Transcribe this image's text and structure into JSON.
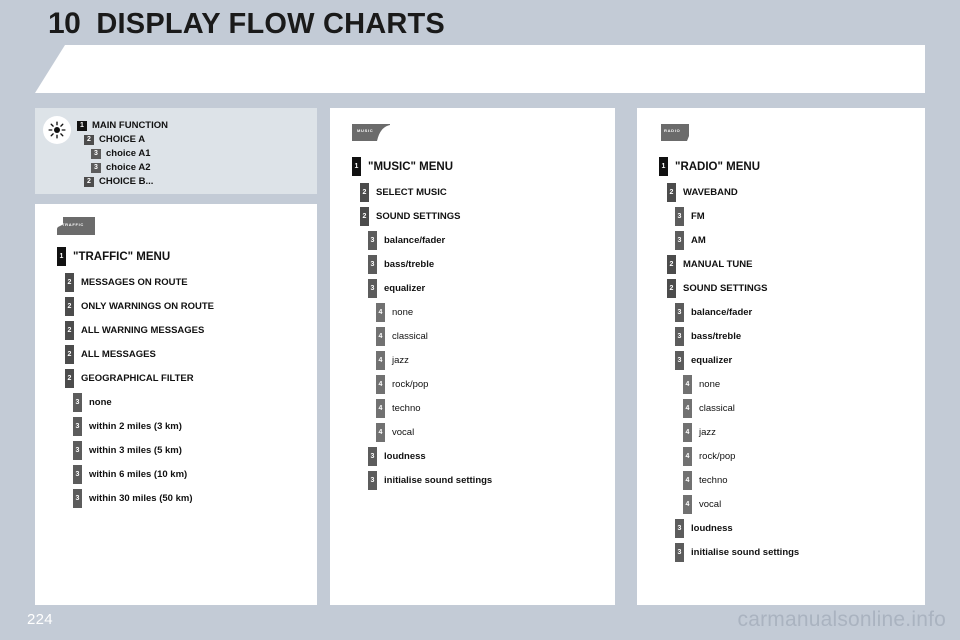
{
  "header": {
    "chapter_number": "10",
    "title": "DISPLAY FLOW CHARTS"
  },
  "legend": {
    "icon": "sun-brightness-icon",
    "rows": [
      {
        "level": 1,
        "badge": "1",
        "label": "MAIN FUNCTION",
        "indent": 0
      },
      {
        "level": 2,
        "badge": "2",
        "label": "CHOICE A",
        "indent": 1
      },
      {
        "level": 3,
        "badge": "3",
        "label": "choice A1",
        "indent": 2
      },
      {
        "level": 3,
        "badge": "3",
        "label": "choice A2",
        "indent": 2
      },
      {
        "level": 2,
        "badge": "2",
        "label": "CHOICE B...",
        "indent": 1
      }
    ]
  },
  "columns": [
    {
      "id": "traffic",
      "tab_icon_label": "TRAFFIC",
      "tab_icon_name": "traffic-tab-icon",
      "nodes": [
        {
          "level": 1,
          "badge": "1",
          "label": "\"TRAFFIC\" MENU"
        },
        {
          "level": 2,
          "badge": "2",
          "label": "MESSAGES ON ROUTE"
        },
        {
          "level": 2,
          "badge": "2",
          "label": "ONLY WARNINGS ON ROUTE"
        },
        {
          "level": 2,
          "badge": "2",
          "label": "ALL WARNING MESSAGES"
        },
        {
          "level": 2,
          "badge": "2",
          "label": "ALL MESSAGES"
        },
        {
          "level": 2,
          "badge": "2",
          "label": "GEOGRAPHICAL FILTER"
        },
        {
          "level": 3,
          "badge": "3",
          "label": "none"
        },
        {
          "level": 3,
          "badge": "3",
          "label": "within 2 miles (3 km)"
        },
        {
          "level": 3,
          "badge": "3",
          "label": "within 3 miles (5 km)"
        },
        {
          "level": 3,
          "badge": "3",
          "label": "within 6 miles (10 km)"
        },
        {
          "level": 3,
          "badge": "3",
          "label": "within 30 miles (50 km)"
        }
      ]
    },
    {
      "id": "music",
      "tab_icon_label": "MUSIC",
      "tab_icon_name": "music-tab-icon",
      "nodes": [
        {
          "level": 1,
          "badge": "1",
          "label": "\"MUSIC\" MENU"
        },
        {
          "level": 2,
          "badge": "2",
          "label": "SELECT MUSIC"
        },
        {
          "level": 2,
          "badge": "2",
          "label": "SOUND SETTINGS"
        },
        {
          "level": 3,
          "badge": "3",
          "label": "balance/fader"
        },
        {
          "level": 3,
          "badge": "3",
          "label": "bass/treble"
        },
        {
          "level": 3,
          "badge": "3",
          "label": "equalizer"
        },
        {
          "level": 4,
          "badge": "4",
          "label": "none"
        },
        {
          "level": 4,
          "badge": "4",
          "label": "classical"
        },
        {
          "level": 4,
          "badge": "4",
          "label": "jazz"
        },
        {
          "level": 4,
          "badge": "4",
          "label": "rock/pop"
        },
        {
          "level": 4,
          "badge": "4",
          "label": "techno"
        },
        {
          "level": 4,
          "badge": "4",
          "label": "vocal"
        },
        {
          "level": 3,
          "badge": "3",
          "label": "loudness"
        },
        {
          "level": 3,
          "badge": "3",
          "label": "initialise sound settings"
        }
      ]
    },
    {
      "id": "radio",
      "tab_icon_label": "RADIO",
      "tab_icon_name": "radio-tab-icon",
      "nodes": [
        {
          "level": 1,
          "badge": "1",
          "label": "\"RADIO\" MENU"
        },
        {
          "level": 2,
          "badge": "2",
          "label": "WAVEBAND"
        },
        {
          "level": 3,
          "badge": "3",
          "label": "FM"
        },
        {
          "level": 3,
          "badge": "3",
          "label": "AM"
        },
        {
          "level": 2,
          "badge": "2",
          "label": "MANUAL TUNE"
        },
        {
          "level": 2,
          "badge": "2",
          "label": "SOUND SETTINGS"
        },
        {
          "level": 3,
          "badge": "3",
          "label": "balance/fader"
        },
        {
          "level": 3,
          "badge": "3",
          "label": "bass/treble"
        },
        {
          "level": 3,
          "badge": "3",
          "label": "equalizer"
        },
        {
          "level": 4,
          "badge": "4",
          "label": "none"
        },
        {
          "level": 4,
          "badge": "4",
          "label": "classical"
        },
        {
          "level": 4,
          "badge": "4",
          "label": "jazz"
        },
        {
          "level": 4,
          "badge": "4",
          "label": "rock/pop"
        },
        {
          "level": 4,
          "badge": "4",
          "label": "techno"
        },
        {
          "level": 4,
          "badge": "4",
          "label": "vocal"
        },
        {
          "level": 3,
          "badge": "3",
          "label": "loudness"
        },
        {
          "level": 3,
          "badge": "3",
          "label": "initialise sound settings"
        }
      ]
    }
  ],
  "footer": {
    "page_number": "224",
    "watermark": "carmanualsonline.info"
  },
  "colors": {
    "background": "#c3cbd6",
    "panel": "#ffffff",
    "legend_panel": "#dde3e8",
    "level1_badge": "#111111",
    "level2_badge": "#4c4c4c",
    "level3_badge": "#5c5c5c",
    "level4_badge": "#717171",
    "tab_icon": "#6b6b6b",
    "page_number": "#ffffff",
    "watermark": "#aab3c0"
  }
}
